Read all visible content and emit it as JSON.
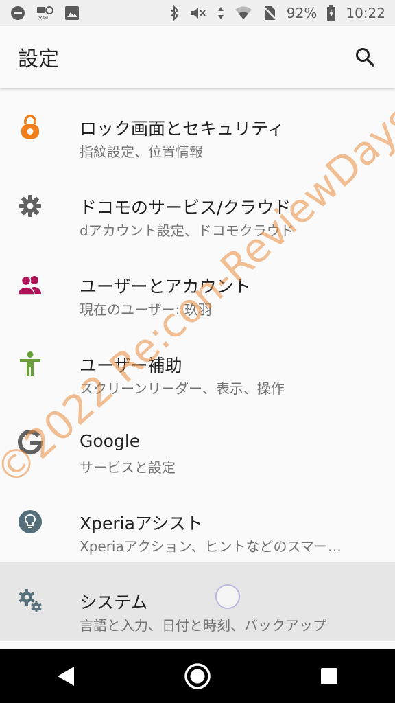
{
  "status_bar": {
    "battery": "92%",
    "time": "10:22"
  },
  "app_bar": {
    "title": "設定",
    "search_icon": "search-icon"
  },
  "settings": [
    {
      "title": "ロック画面とセキュリティ",
      "subtitle": "指紋設定、位置情報",
      "icon": "lock-icon",
      "color": "#f07f1b"
    },
    {
      "title": "ドコモのサービス/クラウド",
      "subtitle": "dアカウント設定、ドコモクラウド",
      "icon": "gear-icon",
      "color": "#616161"
    },
    {
      "title": "ユーザーとアカウント",
      "subtitle": "現在のユーザー: 玖羽",
      "icon": "users-icon",
      "color": "#ad1457"
    },
    {
      "title": "ユーザー補助",
      "subtitle": "スクリーンリーダー、表示、操作",
      "icon": "accessibility-icon",
      "color": "#689f38"
    },
    {
      "title": "Google",
      "subtitle": "サービスと設定",
      "icon": "google-icon",
      "color": "#616161"
    },
    {
      "title": "Xperiaアシスト",
      "subtitle": "Xperiaアクション、ヒントなどのスマー…",
      "icon": "lightbulb-icon",
      "color": "#546e7a"
    },
    {
      "title": "システム",
      "subtitle": "言語と入力、日付と時刻、バックアップ",
      "icon": "system-gears-icon",
      "color": "#546e7a"
    }
  ],
  "watermark": "©2022 Re:con-ReviewDays"
}
